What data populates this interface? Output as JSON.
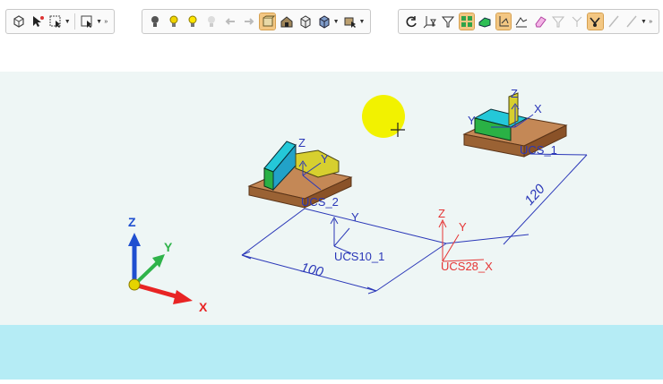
{
  "toolbar": {
    "group1": [
      "model-view-icon",
      "select-pointer-icon",
      "box-select-icon",
      "window-select-icon"
    ],
    "group2": [
      "light-off-icon",
      "light-bulb-icon",
      "light-bulb-bright-icon",
      "light-disabled-icon",
      "arrow-left-icon",
      "arrow-right-icon",
      "shaded-view-icon",
      "house-part-icon",
      "box-view-icon",
      "cube-view-icon",
      "camera-view-icon"
    ],
    "group3": [
      "rotate-icon",
      "axes-filter-icon",
      "funnel-filter-icon",
      "grid-snap-icon",
      "green-part-icon",
      "ucs-snap-icon",
      "chart-icon",
      "eraser-icon",
      "filter-disabled-icon",
      "axes-disabled-icon",
      "snap-toggle-icon",
      "line-icon",
      "line-dropdown-icon"
    ]
  },
  "scene": {
    "colors": {
      "scene_bg": "#eef6f5",
      "floor": "#b5ecf5",
      "plate": "#b87a4a",
      "block_green": "#33c65a",
      "block_cyan": "#24c8d8",
      "block_yellow": "#d7cf2f",
      "dimension_blue": "#2a37b8",
      "ucs_red": "#e53535",
      "axis_x": "#e82424",
      "axis_y": "#2fb34a",
      "axis_z": "#1f4fd0",
      "light": "#f2f200"
    },
    "ucs_labels": {
      "ucs2": "UCS_2",
      "ucs1": "UCS_1",
      "ucs10": "UCS10_1",
      "ucs28": "UCS28_X"
    },
    "axis_letters": {
      "x": "X",
      "y": "Y",
      "z": "Z"
    },
    "dimensions": {
      "horizontal": "100",
      "diagonal": "120"
    }
  }
}
